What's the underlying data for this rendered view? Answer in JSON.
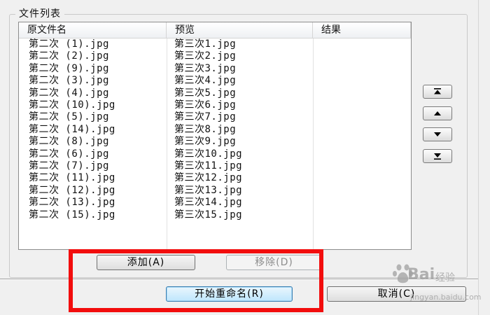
{
  "group": {
    "title": "文件列表"
  },
  "list": {
    "headers": [
      "原文件名",
      "预览",
      "结果"
    ],
    "rows": [
      {
        "original": "第二次 (1).jpg",
        "preview": "第三次1.jpg",
        "result": ""
      },
      {
        "original": "第二次 (2).jpg",
        "preview": "第三次2.jpg",
        "result": ""
      },
      {
        "original": "第二次 (9).jpg",
        "preview": "第三次3.jpg",
        "result": ""
      },
      {
        "original": "第二次 (3).jpg",
        "preview": "第三次4.jpg",
        "result": ""
      },
      {
        "original": "第二次 (4).jpg",
        "preview": "第三次5.jpg",
        "result": ""
      },
      {
        "original": "第二次 (10).jpg",
        "preview": "第三次6.jpg",
        "result": ""
      },
      {
        "original": "第二次 (5).jpg",
        "preview": "第三次7.jpg",
        "result": ""
      },
      {
        "original": "第二次 (14).jpg",
        "preview": "第三次8.jpg",
        "result": ""
      },
      {
        "original": "第二次 (8).jpg",
        "preview": "第三次9.jpg",
        "result": ""
      },
      {
        "original": "第二次 (6).jpg",
        "preview": "第三次10.jpg",
        "result": ""
      },
      {
        "original": "第二次 (7).jpg",
        "preview": "第三次11.jpg",
        "result": ""
      },
      {
        "original": "第二次 (11).jpg",
        "preview": "第三次12.jpg",
        "result": ""
      },
      {
        "original": "第二次 (12).jpg",
        "preview": "第三次13.jpg",
        "result": ""
      },
      {
        "original": "第二次 (13).jpg",
        "preview": "第三次14.jpg",
        "result": ""
      },
      {
        "original": "第二次 (15).jpg",
        "preview": "第三次15.jpg",
        "result": ""
      }
    ]
  },
  "side_buttons": [
    {
      "name": "move-top-button",
      "icon": "move-to-top-icon"
    },
    {
      "name": "move-up-button",
      "icon": "triangle-up-icon"
    },
    {
      "name": "move-down-button",
      "icon": "triangle-down-icon"
    },
    {
      "name": "move-bottom-button",
      "icon": "move-to-bottom-icon"
    }
  ],
  "buttons": {
    "add": "添加(A)",
    "remove": "移除(D)",
    "start": "开始重命名(R)",
    "cancel": "取消(C)"
  },
  "watermark": {
    "brand": "Bai",
    "text": "经验",
    "url": "jingyan.baidu.com"
  },
  "colors": {
    "highlight": "#f20d0d",
    "default_button_border": "#3c7fb1"
  }
}
